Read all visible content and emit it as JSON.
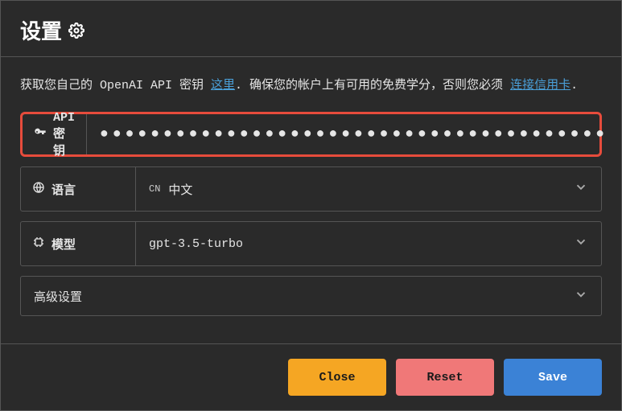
{
  "header": {
    "title": "设置"
  },
  "help": {
    "text_1": "获取您自己的 OpenAI API 密钥 ",
    "link_here": "这里",
    "text_2": ". 确保您的帐户上有可用的免费学分，否则您必须 ",
    "link_card": "连接信用卡",
    "text_3": "."
  },
  "fields": {
    "api_key": {
      "label": "API密钥",
      "value": "●●●●●●●●●●●●●●●●●●●●●●●●●●●●●●●●●●●●●●●●"
    },
    "language": {
      "label": "语言",
      "code": "CN",
      "value": "中文"
    },
    "model": {
      "label": "模型",
      "value": "gpt-3.5-turbo"
    },
    "advanced": {
      "label": "高级设置"
    }
  },
  "buttons": {
    "close": "Close",
    "reset": "Reset",
    "save": "Save"
  }
}
